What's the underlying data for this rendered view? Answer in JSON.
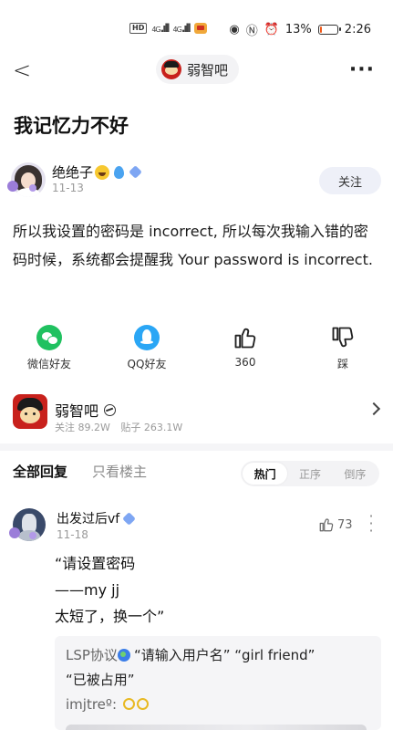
{
  "status_bar": {
    "left_badge": "HD",
    "signal_1": "4G",
    "signal_2": "4G",
    "battery_pct_text": "13%",
    "battery_level": 0.13,
    "time": "2:26",
    "icons": [
      "eye-icon",
      "nfc-icon",
      "alarm-icon",
      "mute-icon",
      "battery-icon"
    ]
  },
  "nav": {
    "forum_name": "弱智吧",
    "more_label": "···"
  },
  "post": {
    "title": "我记忆力不好",
    "author": {
      "name": "绝绝子",
      "date": "11-13"
    },
    "follow_label": "关注",
    "body": "所以我设置的密码是 incorrect, 所以每次我输入错的密码时候，系统都会提醒我 Your password is incorrect."
  },
  "actions": {
    "wechat": "微信好友",
    "qq": "QQ好友",
    "like_count": "360",
    "dislike": "踩"
  },
  "forum_card": {
    "name": "弱智吧",
    "followers": "关注 89.2W",
    "posts": "贴子 263.1W"
  },
  "replies": {
    "tab_all": "全部回复",
    "tab_op_only": "只看楼主",
    "sort_options": [
      "热门",
      "正序",
      "倒序"
    ],
    "active_sort": "热门"
  },
  "comment": {
    "user": "出发过后vf",
    "date": "11-18",
    "likes": "73",
    "lines": [
      "“请设置密码",
      "——my jj",
      "太短了，换一个”"
    ],
    "sub_replies": [
      {
        "user": "LSP协议",
        "text": "“请输入用户名” “girl friend”",
        "text2": "“已被占用”"
      },
      {
        "user": "imjtreº:"
      }
    ]
  },
  "colors": {
    "wechat_green": "#20c160",
    "qq_blue": "#2aa6f5",
    "forum_red": "#c8211c",
    "follow_bg": "#eef0f8"
  }
}
